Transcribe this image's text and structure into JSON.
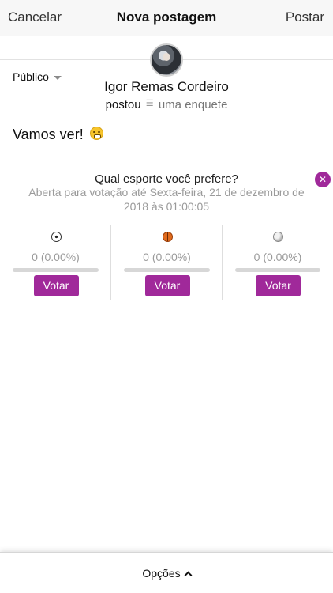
{
  "navbar": {
    "cancel_label": "Cancelar",
    "title": "Nova postagem",
    "post_label": "Postar"
  },
  "composer": {
    "visibility": "Público",
    "user_name": "Igor Remas Cordeiro",
    "verb": "postou",
    "object": "uma enquete",
    "text": "Vamos ver!"
  },
  "poll": {
    "question": "Qual esporte você prefere?",
    "subtitle": "Aberta para votação até Sexta-feira, 21 de dezembro de 2018 às 01:00:05",
    "options": [
      {
        "icon": "soccer-ball-icon",
        "count": "0 (0.00%)",
        "fraction": 0,
        "vote_label": "Votar"
      },
      {
        "icon": "basketball-icon",
        "count": "0 (0.00%)",
        "fraction": 0,
        "vote_label": "Votar"
      },
      {
        "icon": "volleyball-icon",
        "count": "0 (0.00%)",
        "fraction": 0,
        "vote_label": "Votar"
      }
    ]
  },
  "footer": {
    "options_label": "Opções"
  },
  "colors": {
    "accent": "#a0299a"
  }
}
